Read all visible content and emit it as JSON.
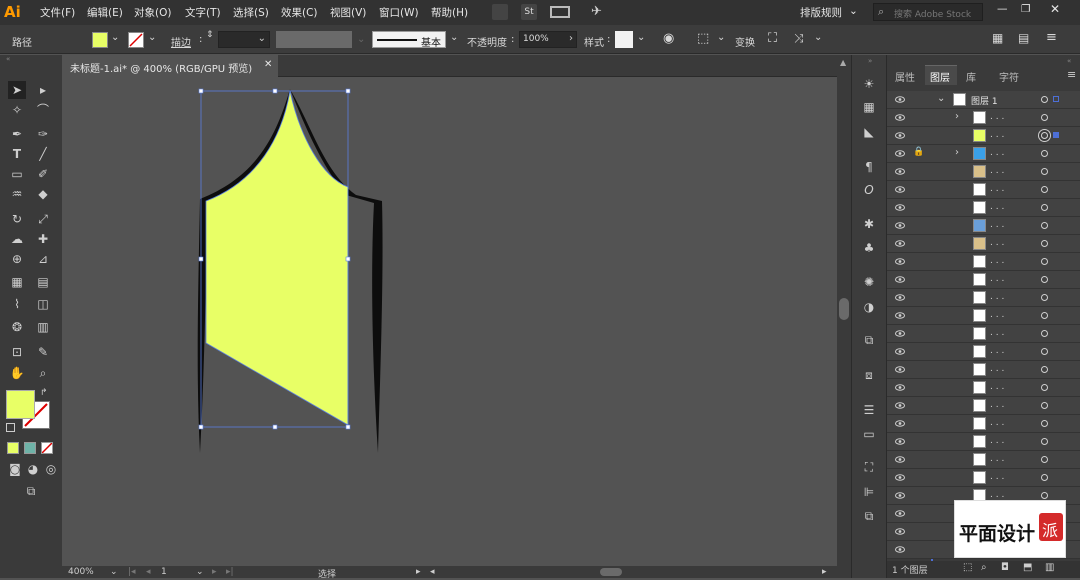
{
  "app": {
    "logo": "Ai"
  },
  "menu": [
    "文件(F)",
    "编辑(E)",
    "对象(O)",
    "文字(T)",
    "选择(S)",
    "效果(C)",
    "视图(V)",
    "窗口(W)",
    "帮助(H)"
  ],
  "top_right": {
    "workspace": "排版规则",
    "search_placeholder": "搜索 Adobe Stock"
  },
  "options": {
    "object_type": "路径",
    "stroke_label": "描边",
    "stroke_style": "基本",
    "opacity_label": "不透明度",
    "opacity_value": "100%",
    "style_label": "样式",
    "transform_label": "变换",
    "fill_color": "#e8ff66"
  },
  "document": {
    "tab_title": "未标题-1.ai* @ 400% (RGB/GPU 预览)"
  },
  "status": {
    "zoom": "400%",
    "artboard": "1",
    "tool": "选择"
  },
  "panel": {
    "tabs": [
      "属性",
      "图层",
      "库",
      "字符"
    ],
    "active_tab": "图层",
    "layer_name": "图层 1",
    "sublayer_dots": ". . .",
    "footer": "1 个图层"
  },
  "watermark": {
    "text": "平面设计",
    "seal": "派"
  }
}
